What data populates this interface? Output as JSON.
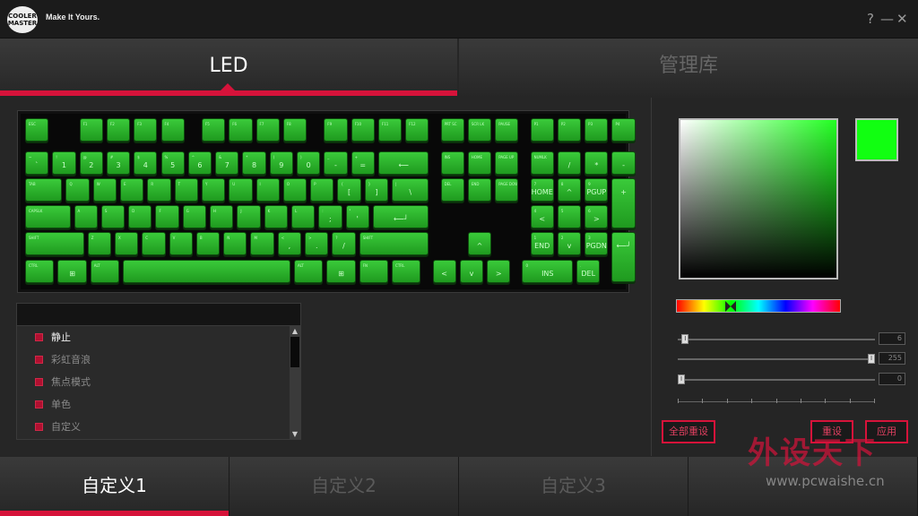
{
  "titlebar": {
    "logo_text": "COOLER MASTER",
    "slogan": "Make It Yours.",
    "help": "?",
    "minimize": "—",
    "close": "✕"
  },
  "top_tabs": [
    {
      "label": "LED",
      "active": true
    },
    {
      "label": "管理库",
      "active": false
    }
  ],
  "effects": {
    "items": [
      {
        "label": "静止",
        "selected": true
      },
      {
        "label": "彩虹音浪",
        "selected": false
      },
      {
        "label": "焦点模式",
        "selected": false
      },
      {
        "label": "单色",
        "selected": false
      },
      {
        "label": "自定义",
        "selected": false
      }
    ]
  },
  "color": {
    "selected_hex": "#11ff11",
    "sliders": [
      {
        "value": "6",
        "fraction": 0.02
      },
      {
        "value": "255",
        "fraction": 1.0
      },
      {
        "value": "0",
        "fraction": 0.0
      }
    ]
  },
  "buttons": {
    "reset_all": "全部重设",
    "reset": "重设",
    "apply": "应用"
  },
  "bottom_tabs": [
    {
      "label": "自定义1",
      "active": true
    },
    {
      "label": "自定义2",
      "active": false
    },
    {
      "label": "自定义3",
      "active": false
    },
    {
      "label": "",
      "active": false
    }
  ],
  "watermark": {
    "big": "外设天下",
    "small": "www.pcwaishe.cn"
  },
  "keyboard": {
    "key_color": "#22bb22",
    "rows": [
      [
        {
          "t": "ESC",
          "g": ""
        },
        {
          "gap": 1
        },
        {
          "t": "F1",
          "g": ""
        },
        {
          "t": "F2",
          "g": ""
        },
        {
          "t": "F3",
          "g": ""
        },
        {
          "t": "F4",
          "g": ""
        },
        {
          "gap": 0.5
        },
        {
          "t": "F5",
          "g": ""
        },
        {
          "t": "F6",
          "g": ""
        },
        {
          "t": "F7",
          "g": ""
        },
        {
          "t": "F8",
          "g": ""
        },
        {
          "gap": 0.5
        },
        {
          "t": "F9",
          "g": ""
        },
        {
          "t": "F10",
          "g": ""
        },
        {
          "t": "F11",
          "g": ""
        },
        {
          "t": "F12",
          "g": ""
        },
        {
          "gap": 0.3
        },
        {
          "t": "PRT SC",
          "g": ""
        },
        {
          "t": "SCR LK",
          "g": ""
        },
        {
          "t": "PAUSE",
          "g": ""
        },
        {
          "gap": 0.3
        },
        {
          "t": "P1",
          "g": ""
        },
        {
          "t": "P2",
          "g": ""
        },
        {
          "t": "P3",
          "g": ""
        },
        {
          "t": "P4",
          "g": ""
        }
      ],
      [
        {
          "t": "~",
          "g": "`"
        },
        {
          "t": "!",
          "g": "1"
        },
        {
          "t": "@",
          "g": "2"
        },
        {
          "t": "#",
          "g": "3"
        },
        {
          "t": "$",
          "g": "4"
        },
        {
          "t": "%",
          "g": "5"
        },
        {
          "t": "^",
          "g": "6"
        },
        {
          "t": "&",
          "g": "7"
        },
        {
          "t": "*",
          "g": "8"
        },
        {
          "t": "(",
          "g": "9"
        },
        {
          "t": ")",
          "g": "0"
        },
        {
          "t": "_",
          "g": "-"
        },
        {
          "t": "+",
          "g": "="
        },
        {
          "t": "",
          "g": "⟵",
          "w": 2
        },
        {
          "gap": 0.3
        },
        {
          "t": "INS",
          "g": ""
        },
        {
          "t": "HOME",
          "g": ""
        },
        {
          "t": "PAGE UP",
          "g": ""
        },
        {
          "gap": 0.3
        },
        {
          "t": "NUMLK",
          "g": ""
        },
        {
          "t": "",
          "g": "/"
        },
        {
          "t": "",
          "g": "*"
        },
        {
          "t": "",
          "g": "-"
        }
      ],
      [
        {
          "t": "TAB",
          "g": "",
          "w": 1.5
        },
        {
          "t": "Q",
          "g": ""
        },
        {
          "t": "W",
          "g": ""
        },
        {
          "t": "E",
          "g": ""
        },
        {
          "t": "R",
          "g": ""
        },
        {
          "t": "T",
          "g": ""
        },
        {
          "t": "Y",
          "g": ""
        },
        {
          "t": "U",
          "g": ""
        },
        {
          "t": "I",
          "g": ""
        },
        {
          "t": "O",
          "g": ""
        },
        {
          "t": "P",
          "g": ""
        },
        {
          "t": "{",
          "g": "["
        },
        {
          "t": "}",
          "g": "]"
        },
        {
          "t": "|",
          "g": "\\",
          "w": 1.5
        },
        {
          "gap": 0.3
        },
        {
          "t": "DEL",
          "g": ""
        },
        {
          "t": "END",
          "g": ""
        },
        {
          "t": "PAGE DOWN",
          "g": ""
        },
        {
          "gap": 0.3
        },
        {
          "t": "7",
          "g": "HOME"
        },
        {
          "t": "8",
          "g": "^"
        },
        {
          "t": "9",
          "g": "PGUP"
        },
        {
          "t": "",
          "g": "+",
          "h": 2
        }
      ],
      [
        {
          "t": "CAPSLK",
          "g": "",
          "w": 1.8
        },
        {
          "t": "A",
          "g": ""
        },
        {
          "t": "S",
          "g": ""
        },
        {
          "t": "D",
          "g": ""
        },
        {
          "t": "F",
          "g": ""
        },
        {
          "t": "G",
          "g": ""
        },
        {
          "t": "H",
          "g": ""
        },
        {
          "t": "J",
          "g": ""
        },
        {
          "t": "K",
          "g": ""
        },
        {
          "t": "L",
          "g": ""
        },
        {
          "t": ":",
          "g": ";"
        },
        {
          "t": "\"",
          "g": "'"
        },
        {
          "t": "",
          "g": "⟵┘",
          "w": 2.2
        },
        {
          "gap": 3.6
        },
        {
          "t": "4",
          "g": "<"
        },
        {
          "t": "5",
          "g": ""
        },
        {
          "t": "6",
          "g": ">"
        }
      ],
      [
        {
          "t": "SHIFT",
          "g": "",
          "w": 2.3
        },
        {
          "t": "Z",
          "g": ""
        },
        {
          "t": "X",
          "g": ""
        },
        {
          "t": "C",
          "g": ""
        },
        {
          "t": "V",
          "g": ""
        },
        {
          "t": "B",
          "g": ""
        },
        {
          "t": "N",
          "g": ""
        },
        {
          "t": "M",
          "g": ""
        },
        {
          "t": "<",
          "g": ","
        },
        {
          "t": ">",
          "g": "."
        },
        {
          "t": "?",
          "g": "/"
        },
        {
          "t": "SHIFT",
          "g": "",
          "w": 2.7
        },
        {
          "gap": 1.3
        },
        {
          "t": "",
          "g": "^"
        },
        {
          "gap": 1.3
        },
        {
          "t": "1",
          "g": "END"
        },
        {
          "t": "2",
          "g": "v"
        },
        {
          "t": "3",
          "g": "PGDN"
        },
        {
          "t": "",
          "g": "⟵┘",
          "h": 2
        }
      ],
      [
        {
          "t": "CTRL",
          "g": "",
          "w": 1.2
        },
        {
          "t": "",
          "g": "⊞",
          "w": 1.2
        },
        {
          "t": "ALT",
          "g": "",
          "w": 1.2
        },
        {
          "t": "",
          "g": "",
          "w": 6.3
        },
        {
          "t": "ALT",
          "g": "",
          "w": 1.2
        },
        {
          "t": "",
          "g": "⊞",
          "w": 1.2
        },
        {
          "t": "FN",
          "g": "",
          "w": 1.2
        },
        {
          "t": "CTRL",
          "g": "",
          "w": 1.2
        },
        {
          "gap": 0.3
        },
        {
          "t": "",
          "g": "<"
        },
        {
          "t": "",
          "g": "v"
        },
        {
          "t": "",
          "g": ">"
        },
        {
          "gap": 0.3
        },
        {
          "t": "0",
          "g": "INS",
          "w": 2
        },
        {
          "t": ".",
          "g": "DEL"
        }
      ]
    ]
  }
}
